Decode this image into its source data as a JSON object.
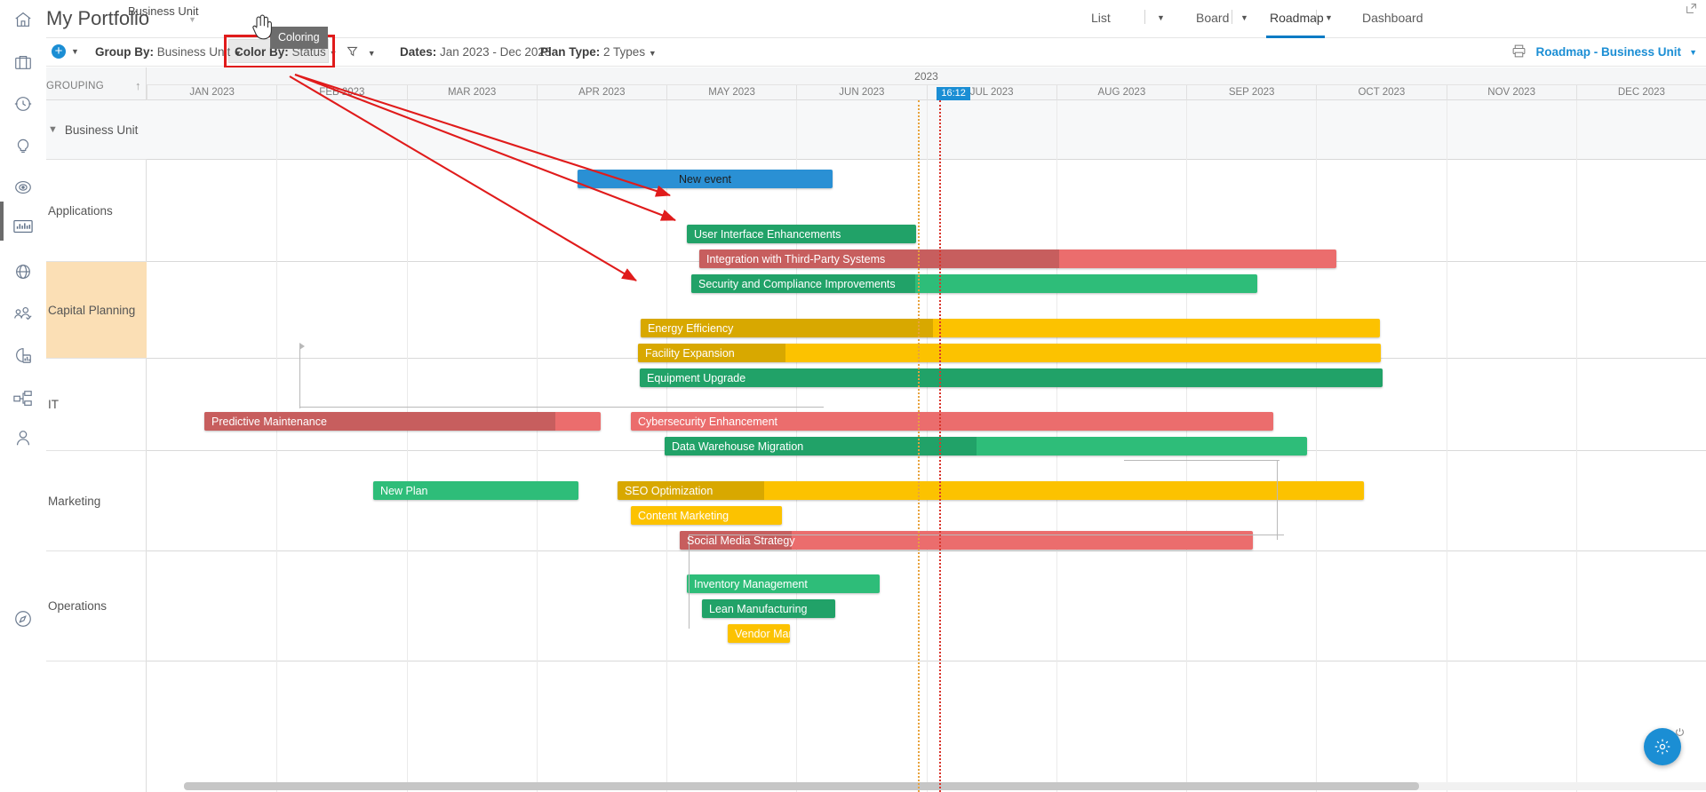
{
  "app": {
    "title": "My Portfolio",
    "subtitle": "Business Unit"
  },
  "view_tabs": [
    {
      "label": "List",
      "active": false,
      "caret": true
    },
    {
      "label": "Board",
      "active": false,
      "caret": true
    },
    {
      "label": "Roadmap",
      "active": true,
      "caret": true
    },
    {
      "label": "Dashboard",
      "active": false,
      "caret": false
    }
  ],
  "toolbar": {
    "add_label": "+",
    "group_by_label": "Group By:",
    "group_by_value": "Business Unit",
    "color_by_label": "Color By:",
    "color_by_value": "Status",
    "filter_icon": "filter-icon",
    "dates_label": "Dates:",
    "dates_value": "Jan 2023 - Dec 2023",
    "plan_type_label": "Plan Type:",
    "plan_type_value": "2 Types",
    "print_icon": "print-icon",
    "roadmap_title": "Roadmap - Business Unit",
    "tooltip": "Coloring",
    "highlight_color": "#e01b1b"
  },
  "grid": {
    "grouping_header": "GROUPING",
    "year": "2023",
    "now_marker": "16:12",
    "months": [
      "JAN 2023",
      "FEB 2023",
      "MAR 2023",
      "APR 2023",
      "MAY 2023",
      "JUN 2023",
      "JUL 2023",
      "AUG 2023",
      "SEP 2023",
      "OCT 2023",
      "NOV 2023",
      "DEC 2023"
    ]
  },
  "rows": [
    {
      "label": "Business Unit",
      "collapsible": true,
      "header": true,
      "highlight": false
    },
    {
      "label": "Applications",
      "collapsible": false,
      "header": false,
      "highlight": false
    },
    {
      "label": "Capital Planning",
      "collapsible": false,
      "header": false,
      "highlight": true
    },
    {
      "label": "IT",
      "collapsible": false,
      "header": false,
      "highlight": false
    },
    {
      "label": "Marketing",
      "collapsible": false,
      "header": false,
      "highlight": false
    },
    {
      "label": "Operations",
      "collapsible": false,
      "header": false,
      "highlight": false
    }
  ],
  "bars": [
    {
      "label": "New event",
      "color": "#2a90d4",
      "progress_color": "#2a90d4",
      "centered": true
    },
    {
      "label": "User Interface Enhancements",
      "color": "#2ebd79",
      "progress_color": "#21a268",
      "centered": false
    },
    {
      "label": "Integration with Third-Party Systems",
      "color": "#eb6d6d",
      "progress_color": "#c75e5e",
      "centered": false
    },
    {
      "label": "Security and Compliance Improvements",
      "color": "#2ebd79",
      "progress_color": "#21a268",
      "centered": false
    },
    {
      "label": "Energy Efficiency",
      "color": "#fcc200",
      "progress_color": "#d8a800",
      "centered": false
    },
    {
      "label": "Facility Expansion",
      "color": "#fcc200",
      "progress_color": "#d8a800",
      "centered": false
    },
    {
      "label": "Equipment Upgrade",
      "color": "#21a268",
      "progress_color": "#21a268",
      "centered": false
    },
    {
      "label": "Predictive Maintenance",
      "color": "#eb6d6d",
      "progress_color": "#c75e5e",
      "centered": false
    },
    {
      "label": "Cybersecurity Enhancement",
      "color": "#eb6d6d",
      "progress_color": "#eb6d6d",
      "centered": false
    },
    {
      "label": "Data Warehouse Migration",
      "color": "#2ebd79",
      "progress_color": "#21a268",
      "centered": false
    },
    {
      "label": "New Plan",
      "color": "#2ebd79",
      "progress_color": "#2ebd79",
      "centered": false
    },
    {
      "label": "SEO Optimization",
      "color": "#fcc200",
      "progress_color": "#d8a800",
      "centered": false
    },
    {
      "label": "Content Marketing",
      "color": "#fcc200",
      "progress_color": "#fcc200",
      "centered": false
    },
    {
      "label": "Social Media Strategy",
      "color": "#eb6d6d",
      "progress_color": "#c75e5e",
      "centered": false
    },
    {
      "label": "Inventory Management",
      "color": "#2ebd79",
      "progress_color": "#2ebd79",
      "centered": false
    },
    {
      "label": "Lean Manufacturing",
      "color": "#21a268",
      "progress_color": "#21a268",
      "centered": false
    },
    {
      "label": "Vendor Man",
      "color": "#fcc200",
      "progress_color": "#fcc200",
      "centered": false
    }
  ],
  "rail_icons": [
    "home-icon",
    "briefcase-icon",
    "clock-icon",
    "bulb-icon",
    "target-icon",
    "chart-icon",
    "globe-icon",
    "users-check-icon",
    "pie-report-icon",
    "hierarchy-icon",
    "person-icon",
    "compass-icon"
  ],
  "fab": {
    "icon": "settings-icon",
    "badge_icon": "power-icon"
  },
  "colors": {
    "accent": "#1b8ed4",
    "green": "#2ebd79",
    "green_dark": "#21a268",
    "red": "#eb6d6d",
    "red_dark": "#c75e5e",
    "yellow": "#fcc200",
    "yellow_dark": "#d8a800",
    "highlight_row": "#fbdfb5",
    "marker_orange": "#e8a33d",
    "marker_red": "#d9352c"
  }
}
